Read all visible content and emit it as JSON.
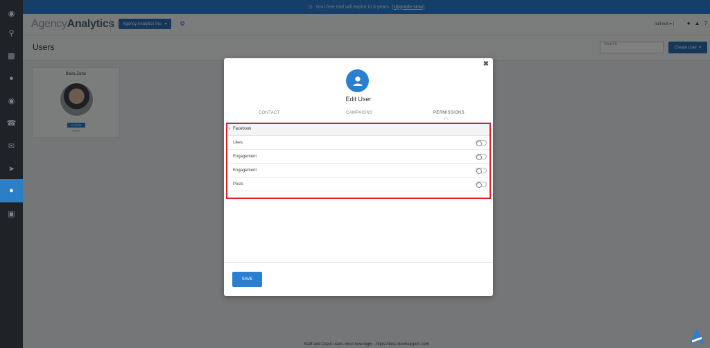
{
  "trial_banner": {
    "text": "Your free trial will expire in 3 years",
    "link": "(Upgrade Now)"
  },
  "header": {
    "logo_light": "Agency",
    "logo_bold": "Analytics",
    "agency_select": "Agency Analytics Inc.",
    "user_menu": "null null"
  },
  "page": {
    "title": "Users",
    "search_placeholder": "Search",
    "create_button": "Create User"
  },
  "user_card": {
    "name": "Baira Zafar",
    "role": "CLIENT",
    "status": "Offline"
  },
  "modal": {
    "title": "Edit User",
    "tabs": [
      "CONTACT",
      "CAMPAIGNS",
      "PERMISSIONS"
    ],
    "active_tab": "PERMISSIONS",
    "section": "Facebook",
    "permissions": [
      {
        "label": "Likes",
        "enabled": false
      },
      {
        "label": "Engagement",
        "enabled": false
      },
      {
        "label": "Engagement",
        "enabled": false
      },
      {
        "label": "Posts",
        "enabled": false
      }
    ],
    "save_label": "SAVE"
  },
  "footer": {
    "text": "Staff and Client users must now login - https://test.clientsupport.com"
  },
  "colors": {
    "accent": "#2b7fd1",
    "highlight": "#e01b24",
    "sidebar": "#1f2226"
  }
}
